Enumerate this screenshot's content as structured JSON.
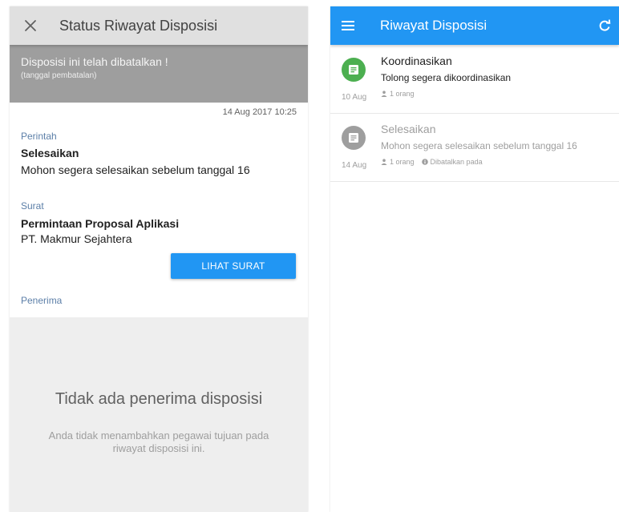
{
  "left": {
    "header": {
      "title": "Status Riwayat Disposisi",
      "close_icon": "close-icon"
    },
    "banner": {
      "message": "Disposisi ini telah dibatalkan !",
      "sub": "(tanggal pembatalan)"
    },
    "date": "14 Aug 2017 10:25",
    "perintah": {
      "label": "Perintah",
      "title": "Selesaikan",
      "detail": "Mohon segera selesaikan sebelum tanggal 16"
    },
    "surat": {
      "label": "Surat",
      "title": "Permintaan Proposal Aplikasi",
      "company": "PT. Makmur Sejahtera",
      "button": "LIHAT SURAT"
    },
    "penerima": {
      "label": "Penerima"
    },
    "empty": {
      "title": "Tidak ada penerima disposisi",
      "desc": "Anda tidak menambahkan pegawai tujuan pada riwayat disposisi ini."
    }
  },
  "right": {
    "header": {
      "title": "Riwayat Disposisi",
      "menu_icon": "menu-icon",
      "refresh_icon": "refresh-icon"
    },
    "items": [
      {
        "date": "10 Aug",
        "title": "Koordinasikan",
        "message": "Tolong segera dikoordinasikan",
        "recipients": "1 orang",
        "status": "",
        "avatar_color": "#4caf50",
        "icon": "document-icon"
      },
      {
        "date": "14 Aug",
        "title": "Selesaikan",
        "message": "Mohon segera selesaikan sebelum tanggal 16",
        "recipients": "1 orang",
        "status": "Dibatalkan pada",
        "avatar_color": "#9e9e9e",
        "icon": "document-icon"
      }
    ]
  },
  "colors": {
    "accent": "#2196f3",
    "active": "#4caf50",
    "cancelled": "#9e9e9e",
    "section_label": "#5c7fa8"
  }
}
